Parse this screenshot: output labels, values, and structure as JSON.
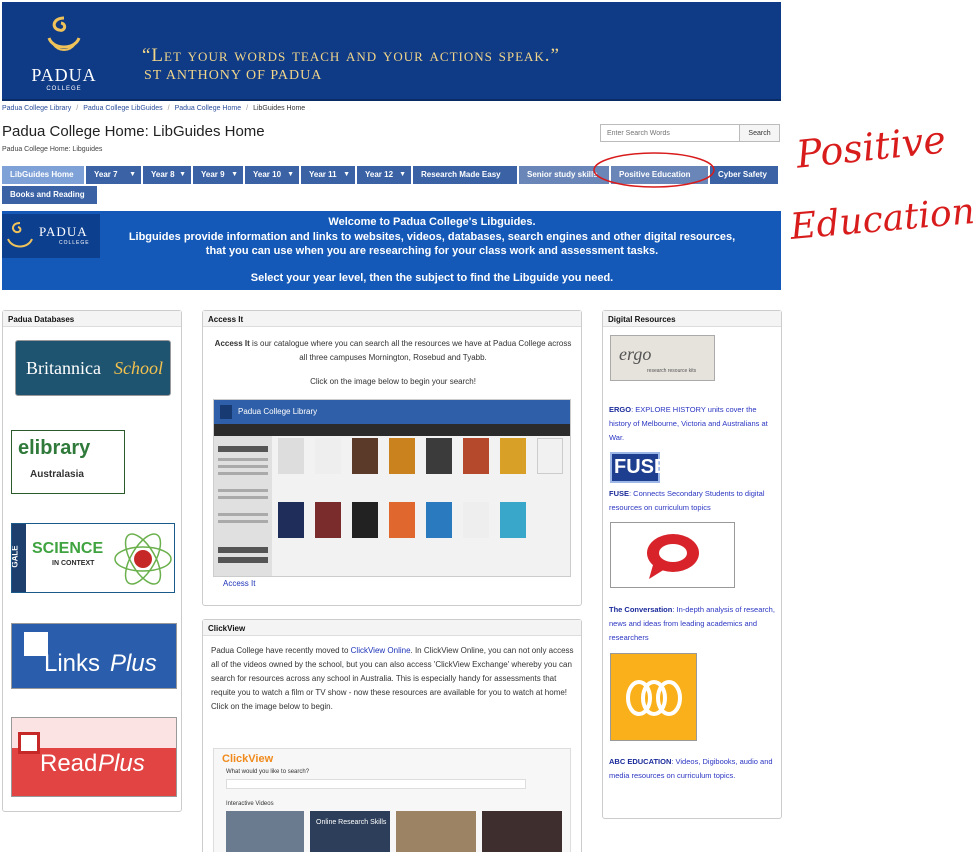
{
  "header": {
    "school_name": "PADUA",
    "school_sub": "COLLEGE",
    "quote": "“Let your words teach and your actions speak.”",
    "quote_author": "ST ANTHONY OF PADUA"
  },
  "breadcrumbs": [
    "Padua College Library",
    "Padua College LibGuides",
    "Padua College Home",
    "LibGuides Home"
  ],
  "page": {
    "title": "Padua College Home: LibGuides Home",
    "subtitle": "Padua College Home: Libguides"
  },
  "search": {
    "placeholder": "Enter Search Words",
    "button_label": "Search"
  },
  "tabs": [
    {
      "label": "LibGuides Home"
    },
    {
      "label": "Year 7"
    },
    {
      "label": "Year 8"
    },
    {
      "label": "Year 9"
    },
    {
      "label": "Year 10"
    },
    {
      "label": "Year 11"
    },
    {
      "label": "Year 12"
    },
    {
      "label": "Research Made Easy"
    },
    {
      "label": "Senior study skills"
    },
    {
      "label": "Positive Education"
    },
    {
      "label": "Cyber Safety"
    },
    {
      "label": "Books and Reading"
    }
  ],
  "welcome": {
    "logo_text": "PADUA",
    "logo_sub": "COLLEGE",
    "line1": "Welcome to Padua College's Libguides.",
    "line2": "Libguides provide information and links to websites, videos, databases, search engines and other digital resources,",
    "line3": "that you can use when you are researching for your class work and assessment tasks.",
    "line4": "Select your year level, then the subject to find the Libguide you need."
  },
  "databases": {
    "title": "Padua Databases",
    "items": [
      {
        "name": "Britannica",
        "suffix": "School"
      },
      {
        "name": "elibrary",
        "suffix": "Australasia"
      },
      {
        "name": "SCIENCE",
        "suffix": "IN CONTEXT",
        "tag": "GALE"
      },
      {
        "name": "Links",
        "suffix": "Plus"
      },
      {
        "name": "Read",
        "suffix": "Plus"
      }
    ]
  },
  "access_it": {
    "title": "Access It",
    "bold_lead": "Access It",
    "body": " is our catalogue where you can search all the resources we have at Padua College across all three campuses Mornington, Rosebud and Tyabb.",
    "cta": "Click on the image below to begin your search!",
    "screenshot_title": "Padua College Library",
    "link_label": "Access It"
  },
  "clickview": {
    "title": "ClickView",
    "p1_before": "Padua College have recently moved to ",
    "p1_link": "ClickView Online",
    "p1_after": ". In ClickView Online, you can not only access all of the videos owned by the school, but you can also access 'ClickView Exchange' whereby you can search for resources across any school in Australia. This is especially handy for assessments that requite you to watch a film or TV show - now these resources are available for you to watch at home! Click on the image below to begin.",
    "screenshot_brand": "ClickView",
    "screenshot_prompt": "What would you like to search?",
    "screenshot_section": "Interactive Videos",
    "screenshot_thumb": "Online Research Skills"
  },
  "digital": {
    "title": "Digital Resources",
    "items": [
      {
        "name": "ERGO",
        "desc": ": EXPLORE HISTORY units cover the history of Melbourne, Victoria and Australians at War."
      },
      {
        "name": "FUSE",
        "desc": ": Connects Secondary Students to digital resources on curriculum topics"
      },
      {
        "name": "The Conversation",
        "desc": ": In-depth analysis of research, news and ideas from leading academics and researchers"
      },
      {
        "name": "ABC EDUCATION",
        "desc": ": Videos, Digibooks, audio and media resources on curriculum topics."
      }
    ],
    "ergo_logo": "ergo",
    "ergo_logo_sub": "research resource kits",
    "fuse_logo": "FUSE"
  },
  "annotation": {
    "line1": "Positive",
    "line2": "Education",
    "color": "#d81c1c"
  },
  "colors": {
    "banner": "#0f3a85",
    "tab": "#3a62a5",
    "welcome": "#1459b8",
    "link": "#1d33b8"
  }
}
